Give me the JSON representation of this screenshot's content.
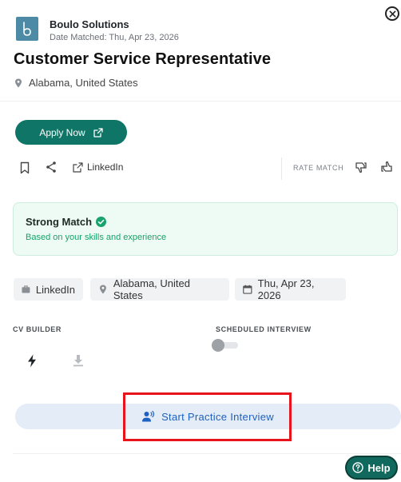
{
  "company": {
    "name": "Boulo Solutions",
    "date_matched": "Date Matched: Thu, Apr 23, 2026",
    "logo_color": "#4c8aa6"
  },
  "job": {
    "title": "Customer Service Representative",
    "location": "Alabama, United States"
  },
  "actions": {
    "apply_label": "Apply Now",
    "linkedin_label": "LinkedIn",
    "rate_match_label": "RATE MATCH"
  },
  "match": {
    "title": "Strong Match",
    "subtitle": "Based on your skills and experience",
    "status_color": "#17a36b"
  },
  "chips": [
    {
      "label": "LinkedIn",
      "icon": "briefcase-icon"
    },
    {
      "label": "Alabama, United States",
      "icon": "map-pin-icon"
    },
    {
      "label": "Thu, Apr 23, 2026",
      "icon": "calendar-icon"
    }
  ],
  "cv_builder": {
    "label": "CV BUILDER"
  },
  "scheduled_interview": {
    "label": "SCHEDULED INTERVIEW",
    "enabled": false
  },
  "practice": {
    "label": "Start Practice Interview"
  },
  "help": {
    "label": "Help"
  },
  "colors": {
    "primary": "#0f7667",
    "practice_text": "#1f61c0",
    "practice_bg": "#e3ecf7",
    "highlight": "#e8141b"
  }
}
